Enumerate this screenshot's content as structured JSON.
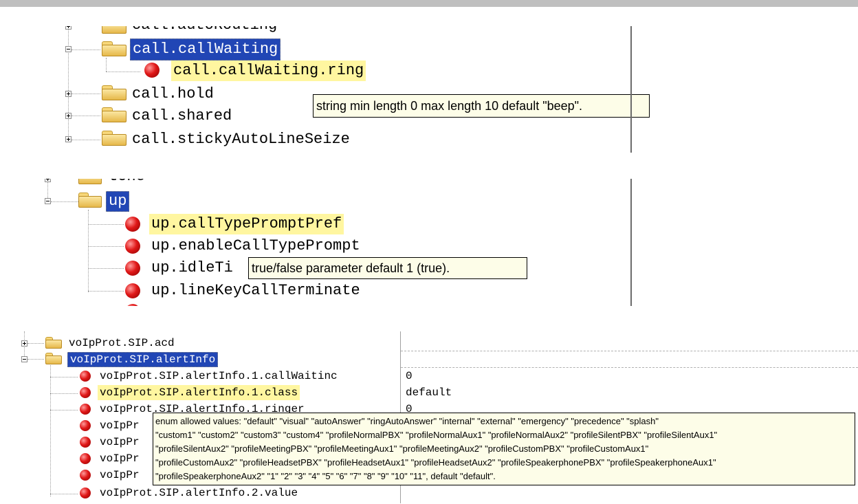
{
  "panel1": {
    "items": {
      "autorouting": "call.autoRouting",
      "callwaiting": "call.callWaiting",
      "ring": "call.callWaiting.ring",
      "hold": "call.hold",
      "shared": "call.shared",
      "sticky": "call.stickyAutoLineSeize"
    },
    "tooltip": "string min length 0 max length 10 default \"beep\"."
  },
  "panel2": {
    "items": {
      "tone": "tone",
      "up": "up",
      "calltype": "up.callTypePromptPref",
      "enable": "up.enableCallTypePrompt",
      "idle": "up.idleTi",
      "linekey": "up.lineKeyCallTerminate"
    },
    "tooltip": "true/false parameter default 1 (true)."
  },
  "panel3": {
    "items": {
      "acd": "voIpProt.SIP.acd",
      "alertinfo": "voIpProt.SIP.alertInfo",
      "callwaiting": "voIpProt.SIP.alertInfo.1.callWaitinc",
      "class": "voIpProt.SIP.alertInfo.1.class",
      "ringer": "voIpProt.SIP.alertInfo.1.ringer",
      "pr1": "voIpPr",
      "pr2": "voIpPr",
      "pr3": "voIpPr",
      "pr4": "voIpPr",
      "value": "voIpProt.SIP.alertInfo.2.value"
    },
    "values": {
      "callwaiting": "0",
      "class": "default",
      "ringer": "0"
    },
    "tooltip": [
      "enum allowed values: \"default\" \"visual\" \"autoAnswer\" \"ringAutoAnswer\" \"internal\" \"external\" \"emergency\" \"precedence\" \"splash\"",
      "\"custom1\" \"custom2\" \"custom3\" \"custom4\" \"profileNormalPBX\" \"profileNormalAux1\" \"profileNormalAux2\" \"profileSilentPBX\" \"profileSilentAux1\"",
      "\"profileSilentAux2\" \"profileMeetingPBX\" \"profileMeetingAux1\" \"profileMeetingAux2\" \"profileCustomPBX\" \"profileCustomAux1\"",
      "\"profileCustomAux2\" \"profileHeadsetPBX\" \"profileHeadsetAux1\" \"profileHeadsetAux2\" \"profileSpeakerphonePBX\" \"profileSpeakerphoneAux1\"",
      "\"profileSpeakerphoneAux2\" \"1\" \"2\" \"3\" \"4\" \"5\" \"6\" \"7\" \"8\" \"9\" \"10\" \"11\", default \"default\"."
    ]
  }
}
